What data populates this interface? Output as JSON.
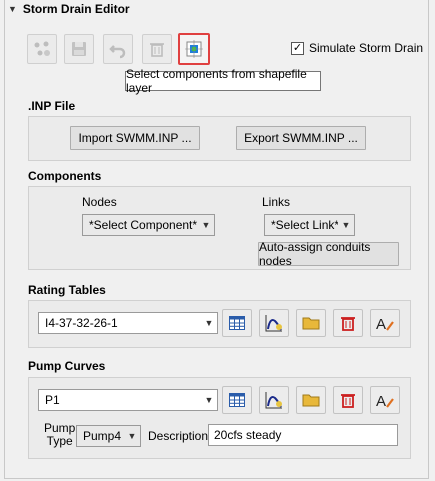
{
  "header": {
    "title": "Storm Drain Editor"
  },
  "toolbar": {
    "buttons": [
      {
        "icon": "add-nodes-icon"
      },
      {
        "icon": "save-icon"
      },
      {
        "icon": "undo-icon"
      },
      {
        "icon": "delete-icon"
      },
      {
        "icon": "select-from-layer-icon"
      }
    ],
    "simulate_label": "Simulate Storm Drain",
    "simulate_checked": true,
    "tooltip": "Select components from shapefile layer"
  },
  "inp": {
    "title": ".INP File",
    "import_label": "Import SWMM.INP ...",
    "export_label": "Export SWMM.INP ..."
  },
  "components": {
    "title": "Components",
    "nodes_label": "Nodes",
    "links_label": "Links",
    "nodes_value": "*Select Component*",
    "links_value": "*Select Link*",
    "auto_assign_label": "Auto-assign conduits nodes"
  },
  "rating": {
    "title": "Rating Tables",
    "value": "I4-37-32-26-1"
  },
  "pump": {
    "title": "Pump Curves",
    "value": "P1",
    "type_label_line1": "Pump",
    "type_label_line2": "Type",
    "type_value": "Pump4",
    "description_label": "Description",
    "description_value": "20cfs steady"
  },
  "colors": {
    "accent_red": "#e04040",
    "delete_red": "#cc2020",
    "folder_yellow": "#e8b83a"
  }
}
